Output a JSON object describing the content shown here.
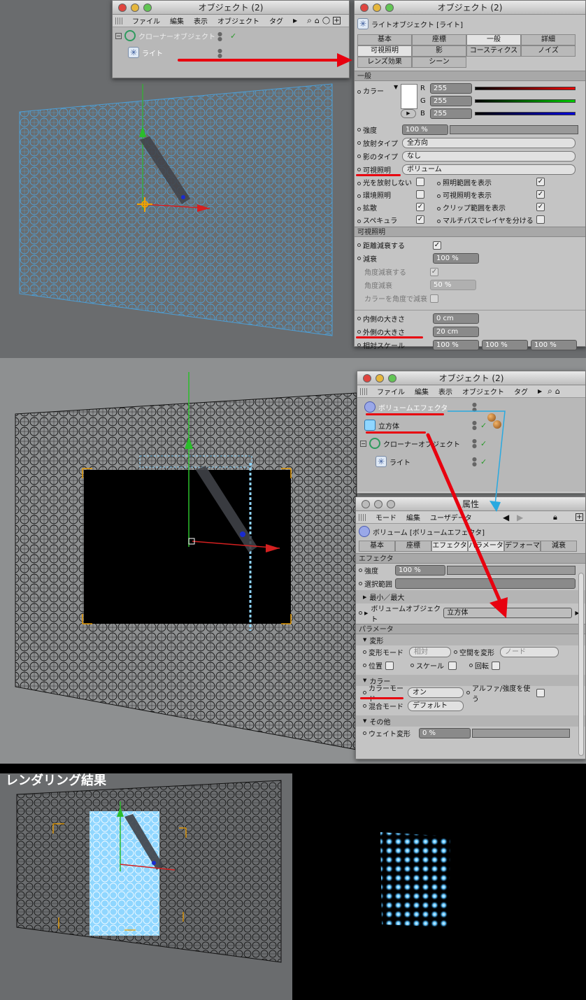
{
  "panel1": {
    "object_manager": {
      "title": "オブジェクト (2)",
      "menu": [
        "ファイル",
        "編集",
        "表示",
        "オブジェクト",
        "タグ"
      ],
      "tree": [
        {
          "name": "クローナーオブジェクト"
        },
        {
          "name": "ライト"
        }
      ]
    },
    "attr": {
      "title": "オブジェクト (2)",
      "object_label": "ライトオブジェクト [ライト]",
      "tabs": [
        "基本",
        "座標",
        "一般",
        "詳細",
        "可視照明",
        "影",
        "コースティクス",
        "ノイズ",
        "レンズ効果",
        "シーン"
      ],
      "active_tab": "一般",
      "section_general": "一般",
      "color_label": "カラー",
      "r_label": "R",
      "g_label": "G",
      "b_label": "B",
      "r": "255",
      "g": "255",
      "b": "255",
      "intensity_label": "強度",
      "intensity": "100 %",
      "emit_type_label": "放射タイプ",
      "emit_type": "全方向",
      "shadow_type_label": "影のタイプ",
      "shadow_type": "なし",
      "visible_light_label": "可視照明",
      "visible_light": "ボリューム",
      "checks_left": [
        {
          "label": "光を放射しない",
          "checked": false
        },
        {
          "label": "環境照明",
          "checked": false
        },
        {
          "label": "拡散",
          "checked": true
        },
        {
          "label": "スペキュラ",
          "checked": true
        }
      ],
      "checks_right": [
        {
          "label": "照明範囲を表示",
          "checked": true
        },
        {
          "label": "可視照明を表示",
          "checked": true
        },
        {
          "label": "クリップ範囲を表示",
          "checked": true
        },
        {
          "label": "マルチパスでレイヤを分ける",
          "checked": false
        }
      ],
      "section_visible": "可視照明",
      "falloff_dist_label": "距離減衰する",
      "falloff_label": "減衰",
      "falloff": "100 %",
      "angle_falloff_label": "角度減衰する",
      "angle_falloff_amt_label": "角度減衰",
      "angle_falloff_amt": "50 %",
      "color_angle_label": "カラーを角度で減衰",
      "inner_size_label": "内側の大きさ",
      "inner_size": "0 cm",
      "outer_size_label": "外側の大きさ",
      "outer_size": "20 cm",
      "rel_scale_label": "相対スケール",
      "rel_scale": [
        "100 %",
        "100 %",
        "100 %"
      ]
    }
  },
  "panel2": {
    "object_manager": {
      "title": "オブジェクト (2)",
      "menu": [
        "ファイル",
        "編集",
        "表示",
        "オブジェクト",
        "タグ"
      ],
      "tree": [
        {
          "name": "ボリュームエフェクタ"
        },
        {
          "name": "立方体"
        },
        {
          "name": "クローナーオブジェクト"
        },
        {
          "name": "ライト"
        }
      ]
    },
    "attr": {
      "title": "属性",
      "menu": [
        "モード",
        "編集",
        "ユーザデータ"
      ],
      "object_label": "ボリューム [ボリュームエフェクタ]",
      "tabs": [
        "基本",
        "座標",
        "エフェクタ",
        "パラメータ",
        "デフォーマ",
        "減衰"
      ],
      "section_effector": "エフェクタ",
      "strength_label": "強度",
      "strength": "100 %",
      "selection_label": "選択範囲",
      "minmax_label": "最小／最大",
      "volume_obj_label": "ボリュームオブジェクト",
      "volume_obj": "立方体",
      "section_param": "パラメータ",
      "sub_transform": "変形",
      "transform_mode_label": "変形モード",
      "transform_mode": "相対",
      "transform_space_label": "空間を変形",
      "transform_space": "ノード",
      "pos_label": "位置",
      "scale_label": "スケール",
      "rot_label": "回転",
      "sub_color": "カラー",
      "color_mode_label": "カラーモード",
      "color_mode": "オン",
      "alpha_label": "アルファ/強度を使う",
      "blend_mode_label": "混合モード",
      "blend_mode": "デフォルト",
      "sub_other": "その他",
      "weight_label": "ウェイト変形",
      "weight": "0 %"
    }
  },
  "panel3": {
    "caption": "レンダリング結果"
  },
  "colors": {
    "red_annotation": "#e8000f",
    "blue_annotation": "#29a9e0",
    "viewport_grey": "#6a6c6e",
    "light_blue": "#8fd6ff"
  }
}
